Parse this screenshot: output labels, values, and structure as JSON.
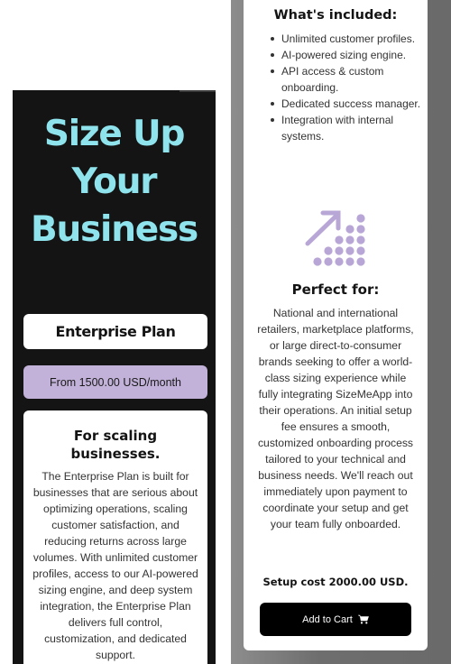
{
  "hero": {
    "title_lines": [
      "Size Up",
      "Your",
      "Business"
    ]
  },
  "plan": {
    "name": "Enterprise Plan",
    "price": "From 1500.00 USD/month",
    "heading": "For scaling businesses.",
    "description": "The Enterprise Plan is built for businesses that are serious about optimizing operations, scaling customer satisfaction, and reducing returns across large volumes. With unlimited customer profiles, access to our AI-powered sizing engine, and deep system integration, the Enterprise Plan delivers full control, customization, and dedicated support."
  },
  "included": {
    "heading": "What's included:",
    "items": [
      "Unlimited customer profiles.",
      "AI-powered sizing engine.",
      "API access & custom onboarding.",
      "Dedicated success manager.",
      "Integration with internal systems."
    ]
  },
  "perfect_for": {
    "icon": "growth-dots-icon",
    "heading": "Perfect for:",
    "body": "National and international retailers, marketplace platforms, or large direct-to-consumer brands seeking to offer a world-class sizing experience while fully integrating SizeMeApp into their operations. An initial setup fee ensures a smooth, customized onboarding process tailored to your technical and business needs. We'll reach out immediately upon payment to coordinate your setup and get your team fully onboarded."
  },
  "setup_cost": "Setup cost 2000.00 USD.",
  "cart_button": {
    "label": "Add to Cart",
    "icon": "cart-icon"
  },
  "colors": {
    "accent_cyan": "#8fe3ec",
    "accent_lavender": "#c2b2d9",
    "dark_bg": "#141414",
    "button_bg": "#000000"
  }
}
